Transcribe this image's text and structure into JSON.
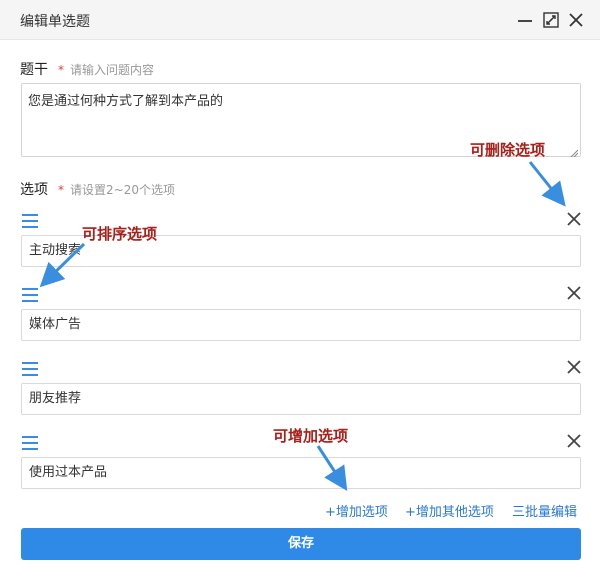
{
  "dialog": {
    "title": "编辑单选题",
    "controls": {
      "minimize_icon": "minimize-icon",
      "maximize_icon": "maximize-icon",
      "close_icon": "close-icon"
    }
  },
  "stem": {
    "label": "题干",
    "required_mark": "*",
    "hint": "请输入问题内容",
    "value": "您是通过何种方式了解到本产品的"
  },
  "options_section": {
    "label": "选项",
    "required_mark": "*",
    "hint": "请设置2~20个选项",
    "items": [
      {
        "value": "主动搜索"
      },
      {
        "value": "媒体广告"
      },
      {
        "value": "朋友推荐"
      },
      {
        "value": "使用过本产品"
      }
    ]
  },
  "actions": {
    "add_option": "+增加选项",
    "add_other_option": "+增加其他选项",
    "batch_edit": "三批量编辑",
    "save": "保存"
  },
  "annotations": {
    "delete_hint": "可删除选项",
    "sort_hint": "可排序选项",
    "add_hint": "可增加选项"
  },
  "colors": {
    "accent": "#2e8ae6",
    "link": "#2a78d0",
    "annotation": "#a8201a",
    "arrow": "#3a8ee0",
    "required": "#e0443c"
  }
}
